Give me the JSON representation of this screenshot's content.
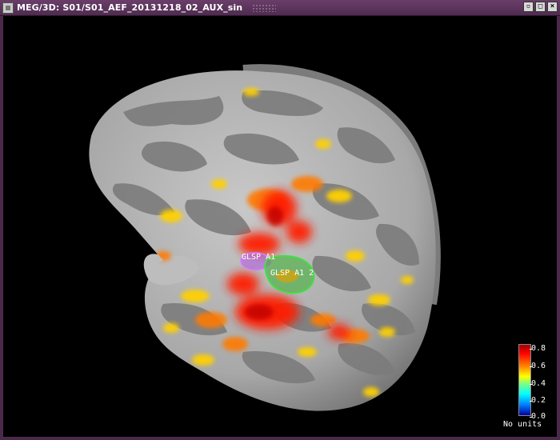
{
  "window": {
    "title": "MEG/3D: S01/S01_AEF_20131218_02_AUX_sin",
    "minimize_glyph": "▫",
    "maximize_glyph": "□",
    "close_glyph": "×"
  },
  "scouts": [
    {
      "label": "GLSP A1",
      "color": "#ffffff"
    },
    {
      "label": "GLSP A1 2",
      "color": "#ffffff"
    }
  ],
  "colorbar": {
    "ticks": [
      "0.8",
      "0.6",
      "0.4",
      "0.2",
      "0.0"
    ],
    "units": "No units"
  },
  "colors": {
    "titlebar": "#5a345a",
    "background": "#000000",
    "cortex_light": "#b4b4b4",
    "cortex_dark": "#808080",
    "activation_hot": "#ff0000",
    "scout_purple": "#b060e0",
    "scout_green": "#30c030"
  }
}
